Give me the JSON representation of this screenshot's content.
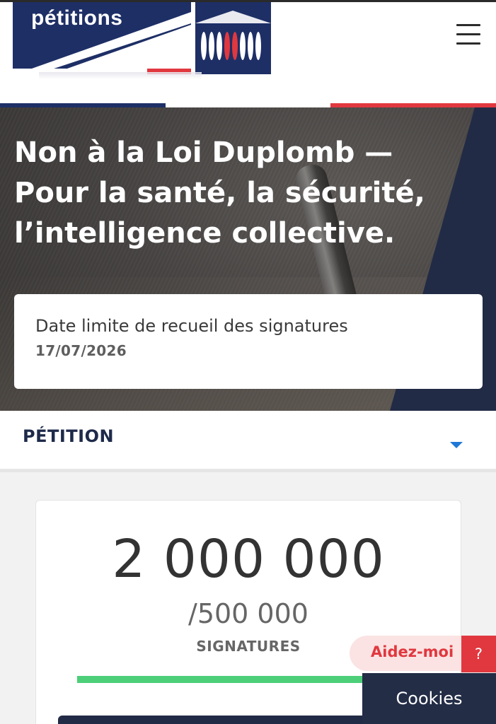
{
  "header": {
    "logo_text": "pétitions",
    "menu_icon": "hamburger-menu-icon"
  },
  "colors": {
    "navy": "#1e2f66",
    "dark_navy": "#232d46",
    "red": "#e1383f",
    "green": "#4ccf78",
    "blue_caret": "#1f78d6"
  },
  "hero": {
    "title": "Non à la Loi Duplomb — Pour la santé, la sécurité, l’intelligence collective.",
    "deadline_label": "Date limite de recueil des signatures",
    "deadline_date": "17/07/2026"
  },
  "section": {
    "title": "PÉTITION",
    "toggle_icon": "caret-down-icon"
  },
  "counter": {
    "signatures": "2 000 000",
    "goal": "/500 000",
    "label": "SIGNATURES",
    "progress": 1.0
  },
  "help": {
    "label": "Aidez-moi",
    "question": "?"
  },
  "cookies": {
    "label": "Cookies"
  }
}
